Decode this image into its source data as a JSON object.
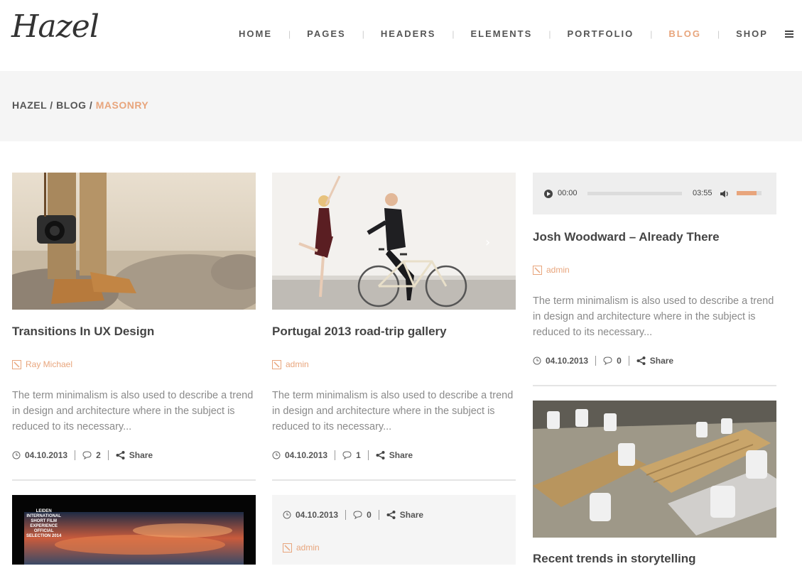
{
  "brand": {
    "logo": "Hazel"
  },
  "nav": {
    "items": [
      "HOME",
      "PAGES",
      "HEADERS",
      "ELEMENTS",
      "PORTFOLIO",
      "BLOG",
      "SHOP"
    ],
    "active": "BLOG"
  },
  "breadcrumb": {
    "root": "HAZEL",
    "sep": " / ",
    "section": "BLOG",
    "current": "MASONRY"
  },
  "posts": [
    {
      "title": "Transitions In UX Design",
      "author": "Ray Michael",
      "excerpt": "The term minimalism is also used to describe a trend in design and architecture where in the subject is reduced to its necessary...",
      "date": "04.10.2013",
      "comments": "2",
      "share": "Share"
    },
    {
      "title": "Portugal 2013 road-trip gallery",
      "author": "admin",
      "excerpt": "The term minimalism is also used to describe a trend in design and architecture where in the subject is reduced to its necessary...",
      "date": "04.10.2013",
      "comments": "1",
      "share": "Share"
    },
    {
      "title": "Josh Woodward – Already There",
      "author": "admin",
      "excerpt": "The term minimalism is also used to describe a trend in design and architecture where in the subject is reduced to its necessary...",
      "date": "04.10.2013",
      "comments": "0",
      "share": "Share"
    },
    {
      "date": "04.10.2013",
      "comments": "0",
      "share": "Share",
      "author": "admin"
    },
    {
      "title": "Recent trends in storytelling"
    }
  ],
  "audio": {
    "current": "00:00",
    "duration": "03:55",
    "progress": 0,
    "volume": 0.8
  },
  "poster": {
    "text": "LEIDEN\nINTERNATIONAL\nSHORT FILM\nEXPERIENCE\nOFFICIAL\nSELECTION 2014"
  },
  "colors": {
    "accent": "#e8a57c",
    "band": "#f5f5f5"
  }
}
